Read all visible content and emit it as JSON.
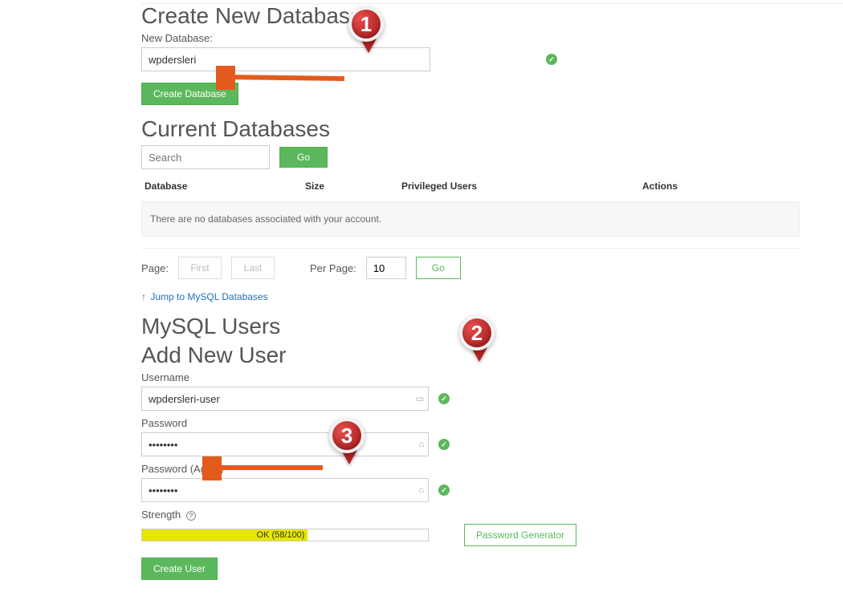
{
  "create_db": {
    "title": "Create New Database",
    "field_label": "New Database:",
    "value": "wpdersleri",
    "button_label": "Create Database"
  },
  "current_db": {
    "title": "Current Databases",
    "search_placeholder": "Search",
    "go_label": "Go",
    "cols": [
      "Database",
      "Size",
      "Privileged Users",
      "Actions"
    ],
    "empty_message": "There are no databases associated with your account."
  },
  "pagination": {
    "page_label": "Page:",
    "first_label": "First",
    "last_label": "Last",
    "perpage_label": "Per Page:",
    "perpage_value": "10",
    "go_label": "Go"
  },
  "jump_link": {
    "text": "Jump to MySQL Databases",
    "arrow": "↑"
  },
  "users": {
    "section_title": "MySQL Users",
    "add_title": "Add New User",
    "username_label": "Username",
    "username_value": "wpdersleri-user",
    "password_label": "Password",
    "password_value": "••••••••",
    "password_again_label": "Password (Again)",
    "password_again_value": "••••••••",
    "strength_label": "Strength",
    "strength_text": "OK (58/100)",
    "strength_percent": 58,
    "generator_label": "Password Generator",
    "create_button": "Create User"
  },
  "annotations": {
    "pin1": "1",
    "pin2": "2",
    "pin3": "3"
  }
}
